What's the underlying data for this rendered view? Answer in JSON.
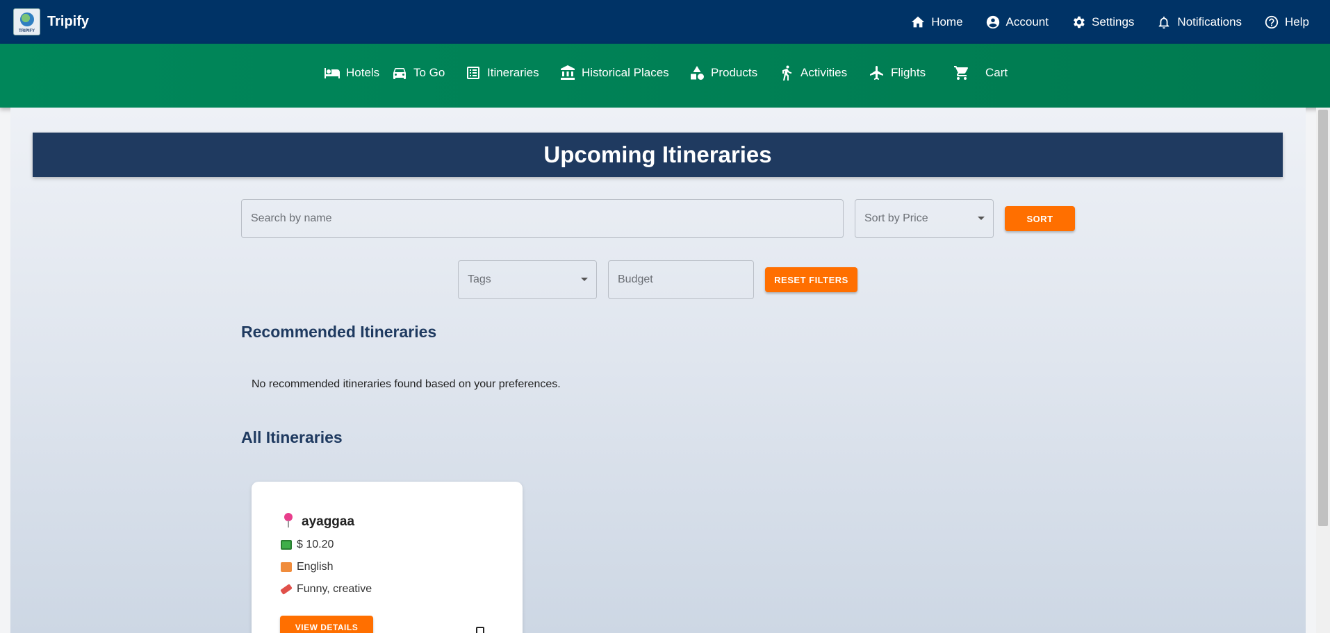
{
  "app": {
    "name": "Tripify",
    "logo_text": "TRIPIFY"
  },
  "topnav": {
    "items": [
      {
        "label": "Home",
        "icon": "home-icon"
      },
      {
        "label": "Account",
        "icon": "account-circle-icon"
      },
      {
        "label": "Settings",
        "icon": "gear-icon"
      },
      {
        "label": "Notifications",
        "icon": "bell-icon"
      },
      {
        "label": "Help",
        "icon": "help-circle-icon"
      }
    ]
  },
  "mainnav": {
    "items": [
      {
        "label": "Hotels",
        "icon": "bed-icon"
      },
      {
        "label": "To Go",
        "icon": "car-icon"
      },
      {
        "label": "Itineraries",
        "icon": "list-icon"
      },
      {
        "label": "Historical Places",
        "icon": "museum-icon"
      },
      {
        "label": "Products",
        "icon": "shapes-icon"
      },
      {
        "label": "Activities",
        "icon": "running-icon"
      },
      {
        "label": "Flights",
        "icon": "airplane-icon"
      },
      {
        "label": "Cart",
        "icon": "cart-icon"
      }
    ]
  },
  "page": {
    "title": "Upcoming Itineraries"
  },
  "filters": {
    "search_placeholder": "Search by name",
    "sort_select": "Sort by Price",
    "sort_button": "SORT",
    "tags_select": "Tags",
    "budget_placeholder": "Budget",
    "reset_button": "RESET FILTERS"
  },
  "recommended": {
    "heading": "Recommended Itineraries",
    "empty_message": "No recommended itineraries found based on your preferences."
  },
  "all": {
    "heading": "All Itineraries",
    "cards": [
      {
        "name": "ayaggaa",
        "price": "$ 10.20",
        "language": "English",
        "tags": "Funny, creative",
        "button": "VIEW DETAILS"
      }
    ]
  },
  "colors": {
    "topbar": "#003366",
    "navbar": "#00875a",
    "banner": "#1f3a60",
    "accent": "#ff6f00"
  }
}
